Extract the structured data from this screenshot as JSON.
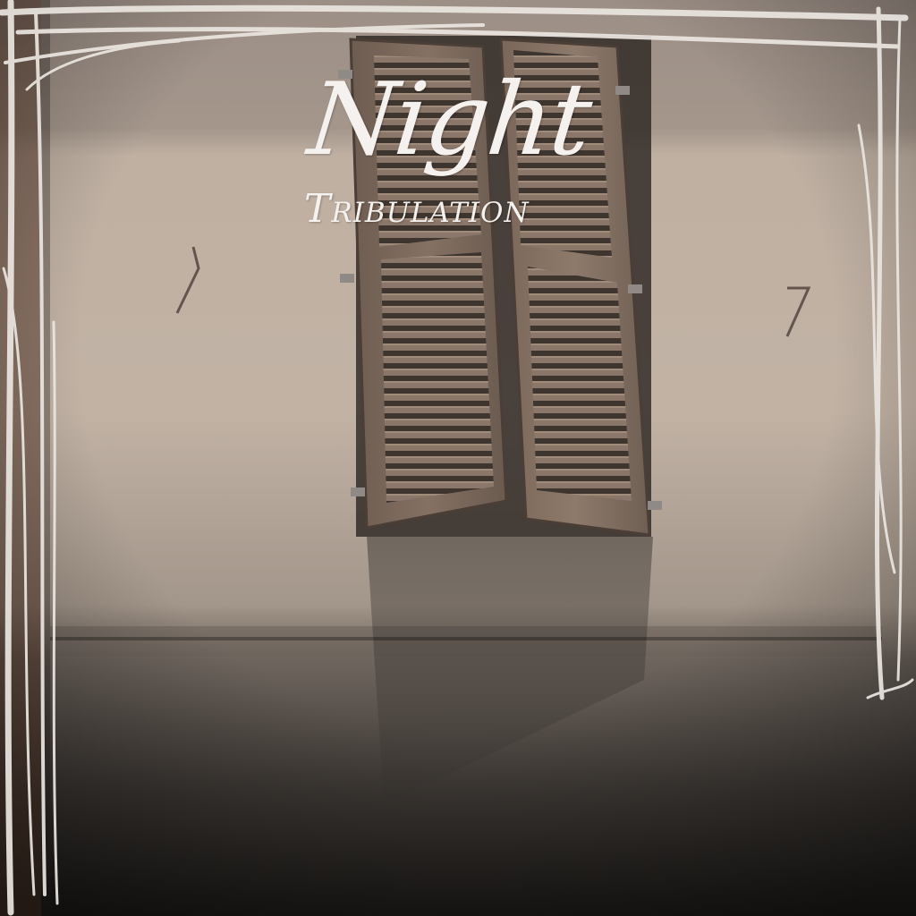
{
  "album": {
    "title": "Night",
    "subtitle": "Tribulation"
  },
  "colors": {
    "wall": "#c2b3a5",
    "ceiling": "#a4968b",
    "shutter_wood": "#7c6a5d",
    "shutter_slat": "#5b4d44",
    "frame_lines": "#e9e4df",
    "title_text": "#f4f1ee"
  },
  "scene": {
    "subject": "window-shutters-icon",
    "border": "hand-drawn-frame-icon"
  }
}
